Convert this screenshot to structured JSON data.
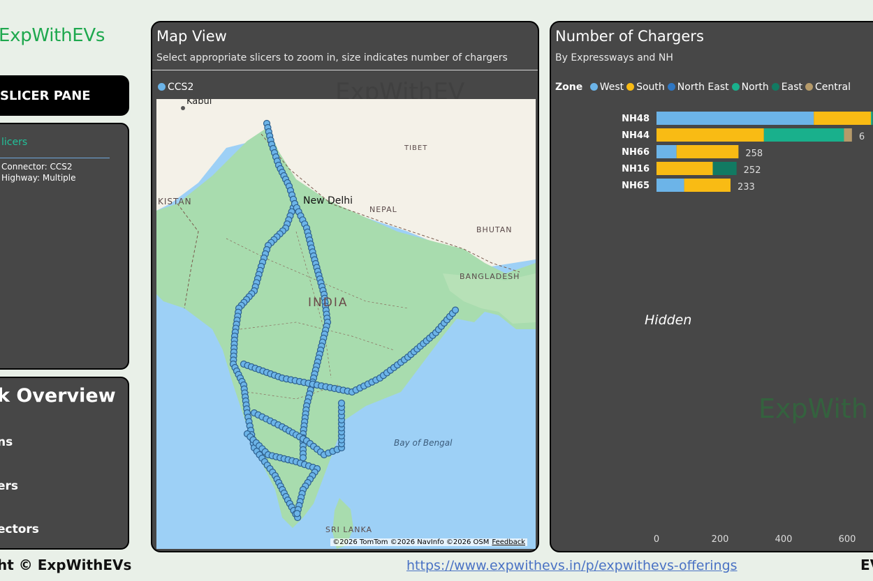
{
  "brand": "ExpWithEVs",
  "slicer_pane": {
    "label": "SLICER PANE"
  },
  "slicers": {
    "title": "licers",
    "connector": "Connector: CCS2",
    "highway": "Highway: Multiple"
  },
  "overview": {
    "title": "k Overview",
    "items": [
      "ns",
      "ers",
      "ectors"
    ]
  },
  "footer": {
    "left": "ht © ExpWithEVs",
    "link": "https://www.expwithevs.in/p/expwithevs-offerings",
    "right": "EV"
  },
  "map_card": {
    "title": "Map View",
    "subtitle": "Select appropriate slicers to zoom in, size indicates number of chargers",
    "legend_label": "CCS2",
    "legend_color": "#6cb4e8",
    "watermark": "ExpWithEV",
    "labels": {
      "kabul": "Kabul",
      "kistan": "KISTAN",
      "new_delhi": "New Delhi",
      "nepal": "NEPAL",
      "tibet": "TIBET",
      "bhutan": "BHUTAN",
      "bangladesh": "BANGLADESH",
      "india": "INDIA",
      "bay_of_bengal": "Bay of Bengal",
      "sri_lanka": "SRI LANKA"
    },
    "attribution": "©2026 TomTom  ©2026 NavInfo  ©2026 OSM",
    "feedback": "Feedback"
  },
  "chart_card": {
    "title": "Number of Chargers",
    "subtitle": "By Expressways and NH",
    "zone_label": "Zone",
    "zones": [
      {
        "name": "West",
        "color": "#6cb4e8"
      },
      {
        "name": "South",
        "color": "#f9bb14"
      },
      {
        "name": "North East",
        "color": "#2f77c3"
      },
      {
        "name": "North",
        "color": "#19b08c"
      },
      {
        "name": "East",
        "color": "#127a62"
      },
      {
        "name": "Central",
        "color": "#b59a6a"
      }
    ],
    "hidden_label": "Hidden",
    "watermark": "ExpWith"
  },
  "chart_data": {
    "type": "bar",
    "orientation": "horizontal",
    "stacked": true,
    "categories": [
      "NH48",
      "NH44",
      "NH66",
      "NH16",
      "NH65"
    ],
    "series": [
      {
        "name": "West",
        "values": [
          495,
          0,
          63,
          0,
          87
        ]
      },
      {
        "name": "South",
        "values": [
          180,
          338,
          195,
          177,
          146
        ]
      },
      {
        "name": "North",
        "values": [
          5,
          252,
          0,
          0,
          0
        ]
      },
      {
        "name": "East",
        "values": [
          0,
          0,
          0,
          75,
          0
        ]
      },
      {
        "name": "Central",
        "values": [
          0,
          25,
          0,
          0,
          0
        ]
      }
    ],
    "data_labels": [
      "",
      "6",
      "258",
      "252",
      "233"
    ],
    "x_ticks": [
      "0",
      "200",
      "400",
      "600"
    ],
    "xlim": [
      0,
      680
    ],
    "grid": false,
    "legend_position": "top"
  }
}
